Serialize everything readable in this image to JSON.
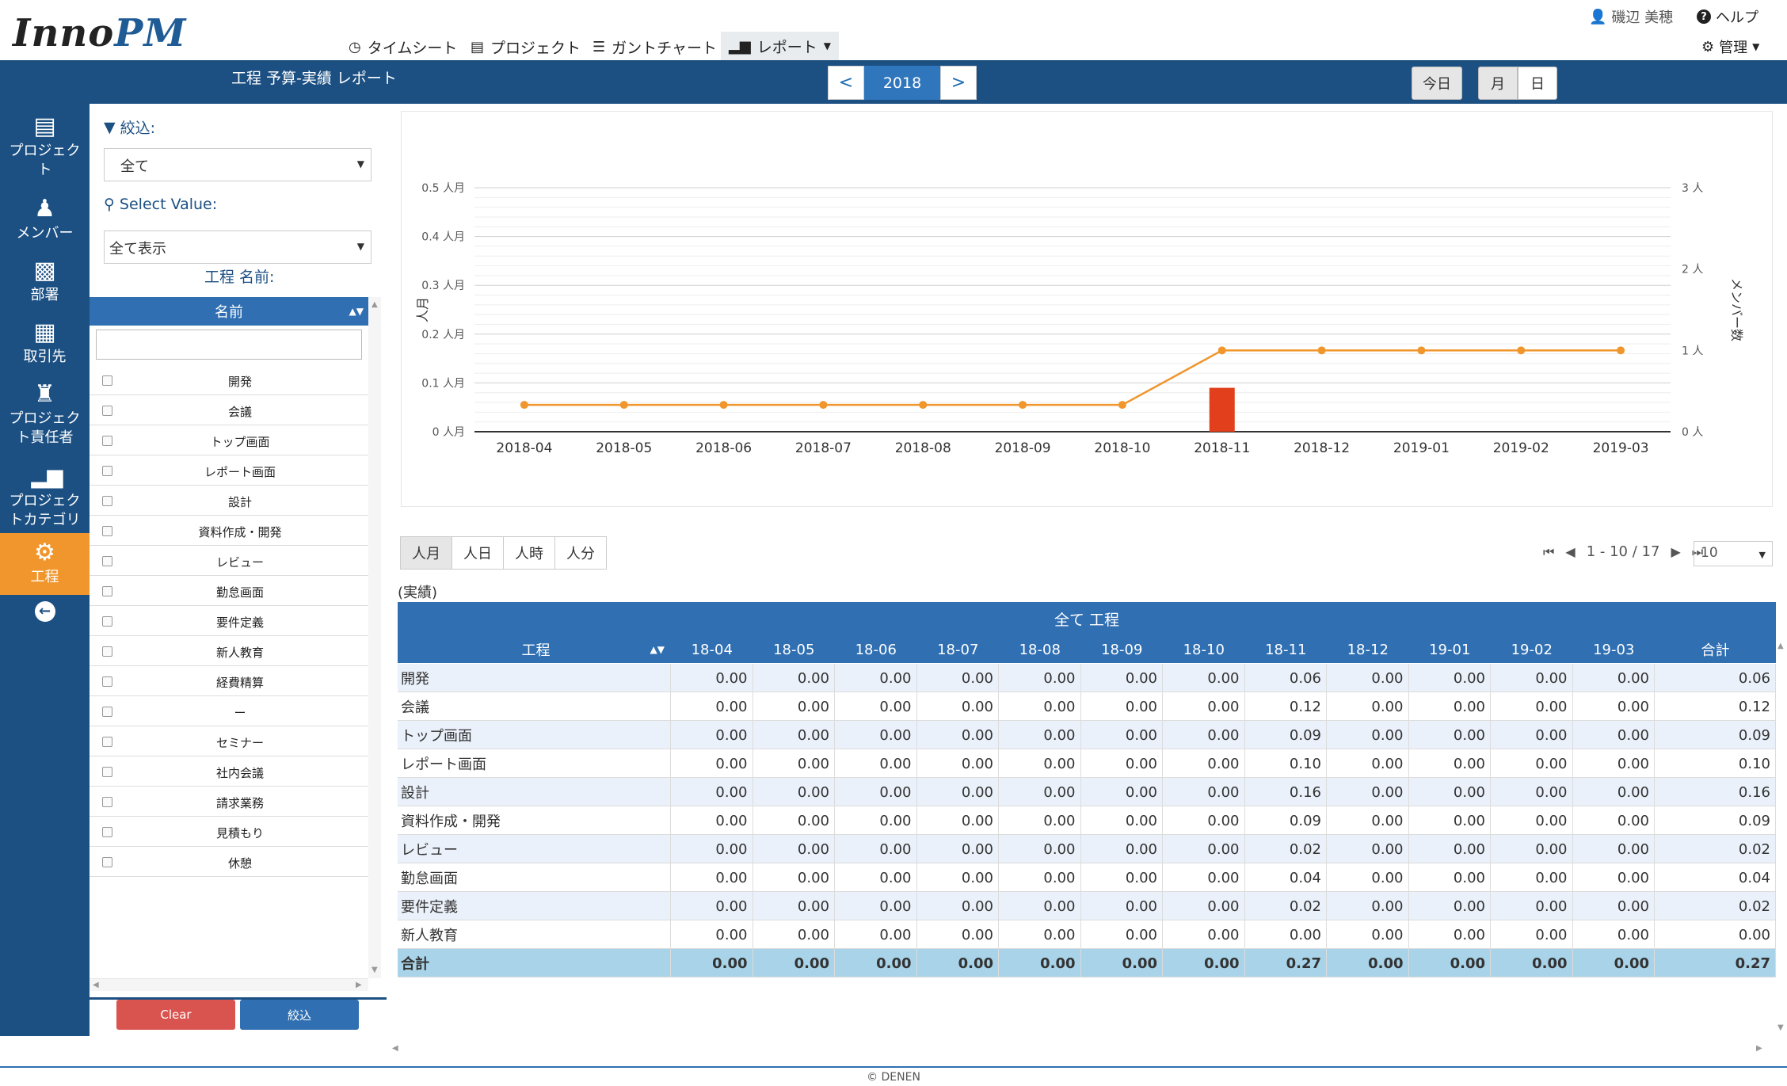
{
  "app": {
    "logo_part1": "Inno",
    "logo_part2": "PM"
  },
  "nav": {
    "timesheet": "タイムシート",
    "project": "プロジェクト",
    "gantt": "ガントチャート",
    "report": "レポート"
  },
  "user": {
    "name": "磯辺 美穂",
    "help": "ヘルプ",
    "admin": "管理"
  },
  "page": {
    "title": "工程 予算-実績 レポート"
  },
  "year_nav": {
    "prev": "<",
    "year": "2018",
    "next": ">"
  },
  "view": {
    "today": "今日",
    "month": "月",
    "day": "日",
    "active": "月"
  },
  "sidebar": {
    "items": [
      {
        "label": "プロジェクト",
        "icon": "server-icon"
      },
      {
        "label": "メンバー",
        "icon": "user-icon"
      },
      {
        "label": "部署",
        "icon": "briefcase-icon"
      },
      {
        "label": "取引先",
        "icon": "list-icon"
      },
      {
        "label": "プロジェクト責任者",
        "icon": "chess-rook-icon"
      },
      {
        "label": "プロジェクトカテゴリ",
        "icon": "bar-chart-icon"
      },
      {
        "label": "工程",
        "icon": "gear-icon"
      }
    ],
    "active_index": 6
  },
  "filter": {
    "narrow_label": "絞込:",
    "narrow_value": "全て",
    "select_label": "Select Value:",
    "select_value": "全て表示",
    "process_name_label": "工程 名前:",
    "grid_header": "名前",
    "search_value": "",
    "items": [
      "開発",
      "会議",
      "トップ画面",
      "レポート画面",
      "設計",
      "資料作成・開発",
      "レビュー",
      "勤怠画面",
      "要件定義",
      "新人教育",
      "経費精算",
      "ー",
      "セミナー",
      "社内会議",
      "請求業務",
      "見積もり",
      "休憩"
    ],
    "clear_button": "Clear",
    "apply_button": "絞込"
  },
  "chart_data": {
    "type": "bar+line",
    "categories": [
      "2018-04",
      "2018-05",
      "2018-06",
      "2018-07",
      "2018-08",
      "2018-09",
      "2018-10",
      "2018-11",
      "2018-12",
      "2019-01",
      "2019-02",
      "2019-03"
    ],
    "series": [
      {
        "type": "bar",
        "axis": "left",
        "values": [
          0,
          0,
          0,
          0,
          0,
          0,
          0,
          0.09,
          0,
          0,
          0,
          0
        ],
        "color": "#e2401c"
      },
      {
        "type": "line",
        "axis": "right",
        "values": [
          0.33,
          0.33,
          0.33,
          0.33,
          0.33,
          0.33,
          0.33,
          1,
          1,
          1,
          1,
          1
        ],
        "color": "#f0962d"
      }
    ],
    "ylabel": "人月",
    "y2label": "メンバー数",
    "ylim": [
      0,
      0.5
    ],
    "y2lim": [
      0,
      3
    ],
    "yticks": [
      "0 人月",
      "0.1 人月",
      "0.2 人月",
      "0.3 人月",
      "0.4 人月",
      "0.5 人月"
    ],
    "y2ticks": [
      "0 人",
      "1 人",
      "2 人",
      "3 人"
    ],
    "grid": true
  },
  "units": {
    "tabs": [
      "人月",
      "人日",
      "人時",
      "人分"
    ],
    "active": "人月"
  },
  "pager": {
    "range": "1 - 10 / 17",
    "page_size": "10"
  },
  "table": {
    "label": "(実績)",
    "super_header": "全て 工程",
    "columns": [
      "工程",
      "18-04",
      "18-05",
      "18-06",
      "18-07",
      "18-08",
      "18-09",
      "18-10",
      "18-11",
      "18-12",
      "19-01",
      "19-02",
      "19-03",
      "合計"
    ],
    "rows": [
      [
        "開発",
        "0.00",
        "0.00",
        "0.00",
        "0.00",
        "0.00",
        "0.00",
        "0.00",
        "0.06",
        "0.00",
        "0.00",
        "0.00",
        "0.00",
        "0.06"
      ],
      [
        "会議",
        "0.00",
        "0.00",
        "0.00",
        "0.00",
        "0.00",
        "0.00",
        "0.00",
        "0.12",
        "0.00",
        "0.00",
        "0.00",
        "0.00",
        "0.12"
      ],
      [
        "トップ画面",
        "0.00",
        "0.00",
        "0.00",
        "0.00",
        "0.00",
        "0.00",
        "0.00",
        "0.09",
        "0.00",
        "0.00",
        "0.00",
        "0.00",
        "0.09"
      ],
      [
        "レポート画面",
        "0.00",
        "0.00",
        "0.00",
        "0.00",
        "0.00",
        "0.00",
        "0.00",
        "0.10",
        "0.00",
        "0.00",
        "0.00",
        "0.00",
        "0.10"
      ],
      [
        "設計",
        "0.00",
        "0.00",
        "0.00",
        "0.00",
        "0.00",
        "0.00",
        "0.00",
        "0.16",
        "0.00",
        "0.00",
        "0.00",
        "0.00",
        "0.16"
      ],
      [
        "資料作成・開発",
        "0.00",
        "0.00",
        "0.00",
        "0.00",
        "0.00",
        "0.00",
        "0.00",
        "0.09",
        "0.00",
        "0.00",
        "0.00",
        "0.00",
        "0.09"
      ],
      [
        "レビュー",
        "0.00",
        "0.00",
        "0.00",
        "0.00",
        "0.00",
        "0.00",
        "0.00",
        "0.02",
        "0.00",
        "0.00",
        "0.00",
        "0.00",
        "0.02"
      ],
      [
        "勤怠画面",
        "0.00",
        "0.00",
        "0.00",
        "0.00",
        "0.00",
        "0.00",
        "0.00",
        "0.04",
        "0.00",
        "0.00",
        "0.00",
        "0.00",
        "0.04"
      ],
      [
        "要件定義",
        "0.00",
        "0.00",
        "0.00",
        "0.00",
        "0.00",
        "0.00",
        "0.00",
        "0.02",
        "0.00",
        "0.00",
        "0.00",
        "0.00",
        "0.02"
      ],
      [
        "新人教育",
        "0.00",
        "0.00",
        "0.00",
        "0.00",
        "0.00",
        "0.00",
        "0.00",
        "0.00",
        "0.00",
        "0.00",
        "0.00",
        "0.00",
        "0.00"
      ]
    ],
    "total": [
      "合計",
      "0.00",
      "0.00",
      "0.00",
      "0.00",
      "0.00",
      "0.00",
      "0.00",
      "0.27",
      "0.00",
      "0.00",
      "0.00",
      "0.00",
      "0.27"
    ]
  },
  "footer": {
    "text": "© DENEN"
  }
}
